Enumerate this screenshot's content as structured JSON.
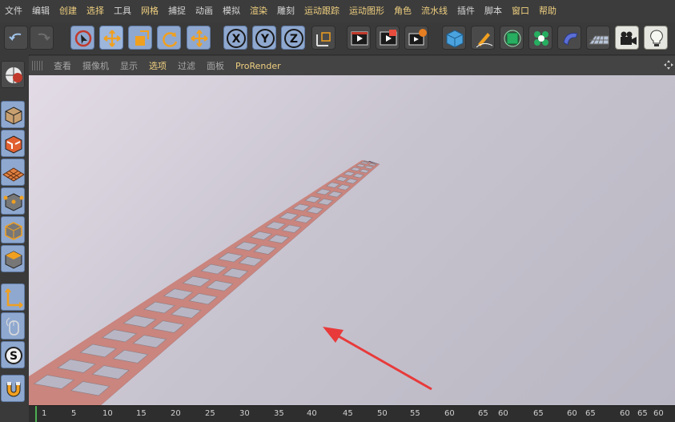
{
  "menubar": {
    "items": [
      {
        "label": "文件",
        "hl": false
      },
      {
        "label": "编辑",
        "hl": false
      },
      {
        "label": "创建",
        "hl": true
      },
      {
        "label": "选择",
        "hl": true
      },
      {
        "label": "工具",
        "hl": false
      },
      {
        "label": "网格",
        "hl": true
      },
      {
        "label": "捕捉",
        "hl": false
      },
      {
        "label": "动画",
        "hl": false
      },
      {
        "label": "模拟",
        "hl": false
      },
      {
        "label": "渲染",
        "hl": true
      },
      {
        "label": "雕刻",
        "hl": false
      },
      {
        "label": "运动跟踪",
        "hl": true
      },
      {
        "label": "运动图形",
        "hl": true
      },
      {
        "label": "角色",
        "hl": true
      },
      {
        "label": "流水线",
        "hl": true
      },
      {
        "label": "插件",
        "hl": false
      },
      {
        "label": "脚本",
        "hl": false
      },
      {
        "label": "窗口",
        "hl": true
      },
      {
        "label": "帮助",
        "hl": true
      }
    ]
  },
  "toolbar": {
    "buttons": [
      {
        "name": "undo-button",
        "icon": "undo-icon",
        "style": "dark"
      },
      {
        "name": "redo-button",
        "icon": "redo-icon",
        "style": "dark"
      },
      {
        "name": "live-selection-button",
        "icon": "live-selection-icon",
        "style": "blue"
      },
      {
        "name": "move-button",
        "icon": "move-icon",
        "style": "sel"
      },
      {
        "name": "scale-button",
        "icon": "scale-icon",
        "style": "blue"
      },
      {
        "name": "rotate-button",
        "icon": "rotate-icon",
        "style": "blue"
      },
      {
        "name": "recent-tool-button",
        "icon": "move-icon",
        "style": "blue"
      },
      {
        "name": "x-axis-button",
        "icon": "x-axis-icon",
        "style": "blue",
        "text": "X"
      },
      {
        "name": "y-axis-button",
        "icon": "y-axis-icon",
        "style": "blue",
        "text": "Y"
      },
      {
        "name": "z-axis-button",
        "icon": "z-axis-icon",
        "style": "blue",
        "text": "Z"
      },
      {
        "name": "coordinate-system-button",
        "icon": "coordinate-system-icon",
        "style": "dark"
      },
      {
        "name": "render-view-button",
        "icon": "render-view-icon",
        "style": "dark"
      },
      {
        "name": "render-picture-viewer-button",
        "icon": "render-picture-viewer-icon",
        "style": "dark"
      },
      {
        "name": "render-settings-button",
        "icon": "render-settings-icon",
        "style": "dark"
      },
      {
        "name": "cube-button",
        "icon": "cube-icon",
        "style": "dark"
      },
      {
        "name": "pen-button",
        "icon": "pen-icon",
        "style": "dark"
      },
      {
        "name": "subdivision-button",
        "icon": "subdivision-icon",
        "style": "dark"
      },
      {
        "name": "cloner-button",
        "icon": "cloner-icon",
        "style": "dark"
      },
      {
        "name": "deformer-button",
        "icon": "deformer-icon",
        "style": "dark"
      },
      {
        "name": "floor-button",
        "icon": "floor-icon",
        "style": "dark"
      },
      {
        "name": "camera-button",
        "icon": "camera-icon",
        "style": "light"
      },
      {
        "name": "light-button",
        "icon": "light-icon",
        "style": "light"
      }
    ]
  },
  "left_panel": {
    "buttons": [
      {
        "name": "make-editable-button",
        "icon": "make-editable-icon"
      },
      {
        "name": "model-mode-button",
        "icon": "model-mode-icon"
      },
      {
        "name": "texture-mode-button",
        "icon": "texture-mode-icon"
      },
      {
        "name": "workplane-mode-button",
        "icon": "workplane-mode-icon"
      },
      {
        "name": "points-mode-button",
        "icon": "points-mode-icon"
      },
      {
        "name": "edges-mode-button",
        "icon": "edges-mode-icon"
      },
      {
        "name": "polygons-mode-button",
        "icon": "polygons-mode-icon"
      },
      {
        "name": "axis-mode-button",
        "icon": "axis-mode-icon"
      },
      {
        "name": "tweak-mode-button",
        "icon": "tweak-mode-icon"
      },
      {
        "name": "snap-button",
        "icon": "snap-icon",
        "text": "S"
      },
      {
        "name": "magnet-button",
        "icon": "magnet-icon"
      }
    ]
  },
  "viewport_menu": {
    "items": [
      {
        "label": "查看",
        "active": false
      },
      {
        "label": "摄像机",
        "active": false
      },
      {
        "label": "显示",
        "active": false
      },
      {
        "label": "选项",
        "active": true
      },
      {
        "label": "过滤",
        "active": false
      },
      {
        "label": "面板",
        "active": false
      },
      {
        "label": "ProRender",
        "active": true
      }
    ]
  },
  "timeline": {
    "ticks": [
      "1",
      "5",
      "10",
      "15",
      "20",
      "25",
      "30",
      "35",
      "40",
      "45",
      "50",
      "55",
      "60",
      "65",
      "60",
      "65",
      "60",
      "65",
      "60",
      "65",
      "60"
    ]
  },
  "colors": {
    "accent_text": "#f0d080",
    "beam_top": "#c9857e",
    "beam_side": "#2b2b48",
    "tile": "#b8b6c4",
    "annotation_arrow": "#e83a3a"
  }
}
